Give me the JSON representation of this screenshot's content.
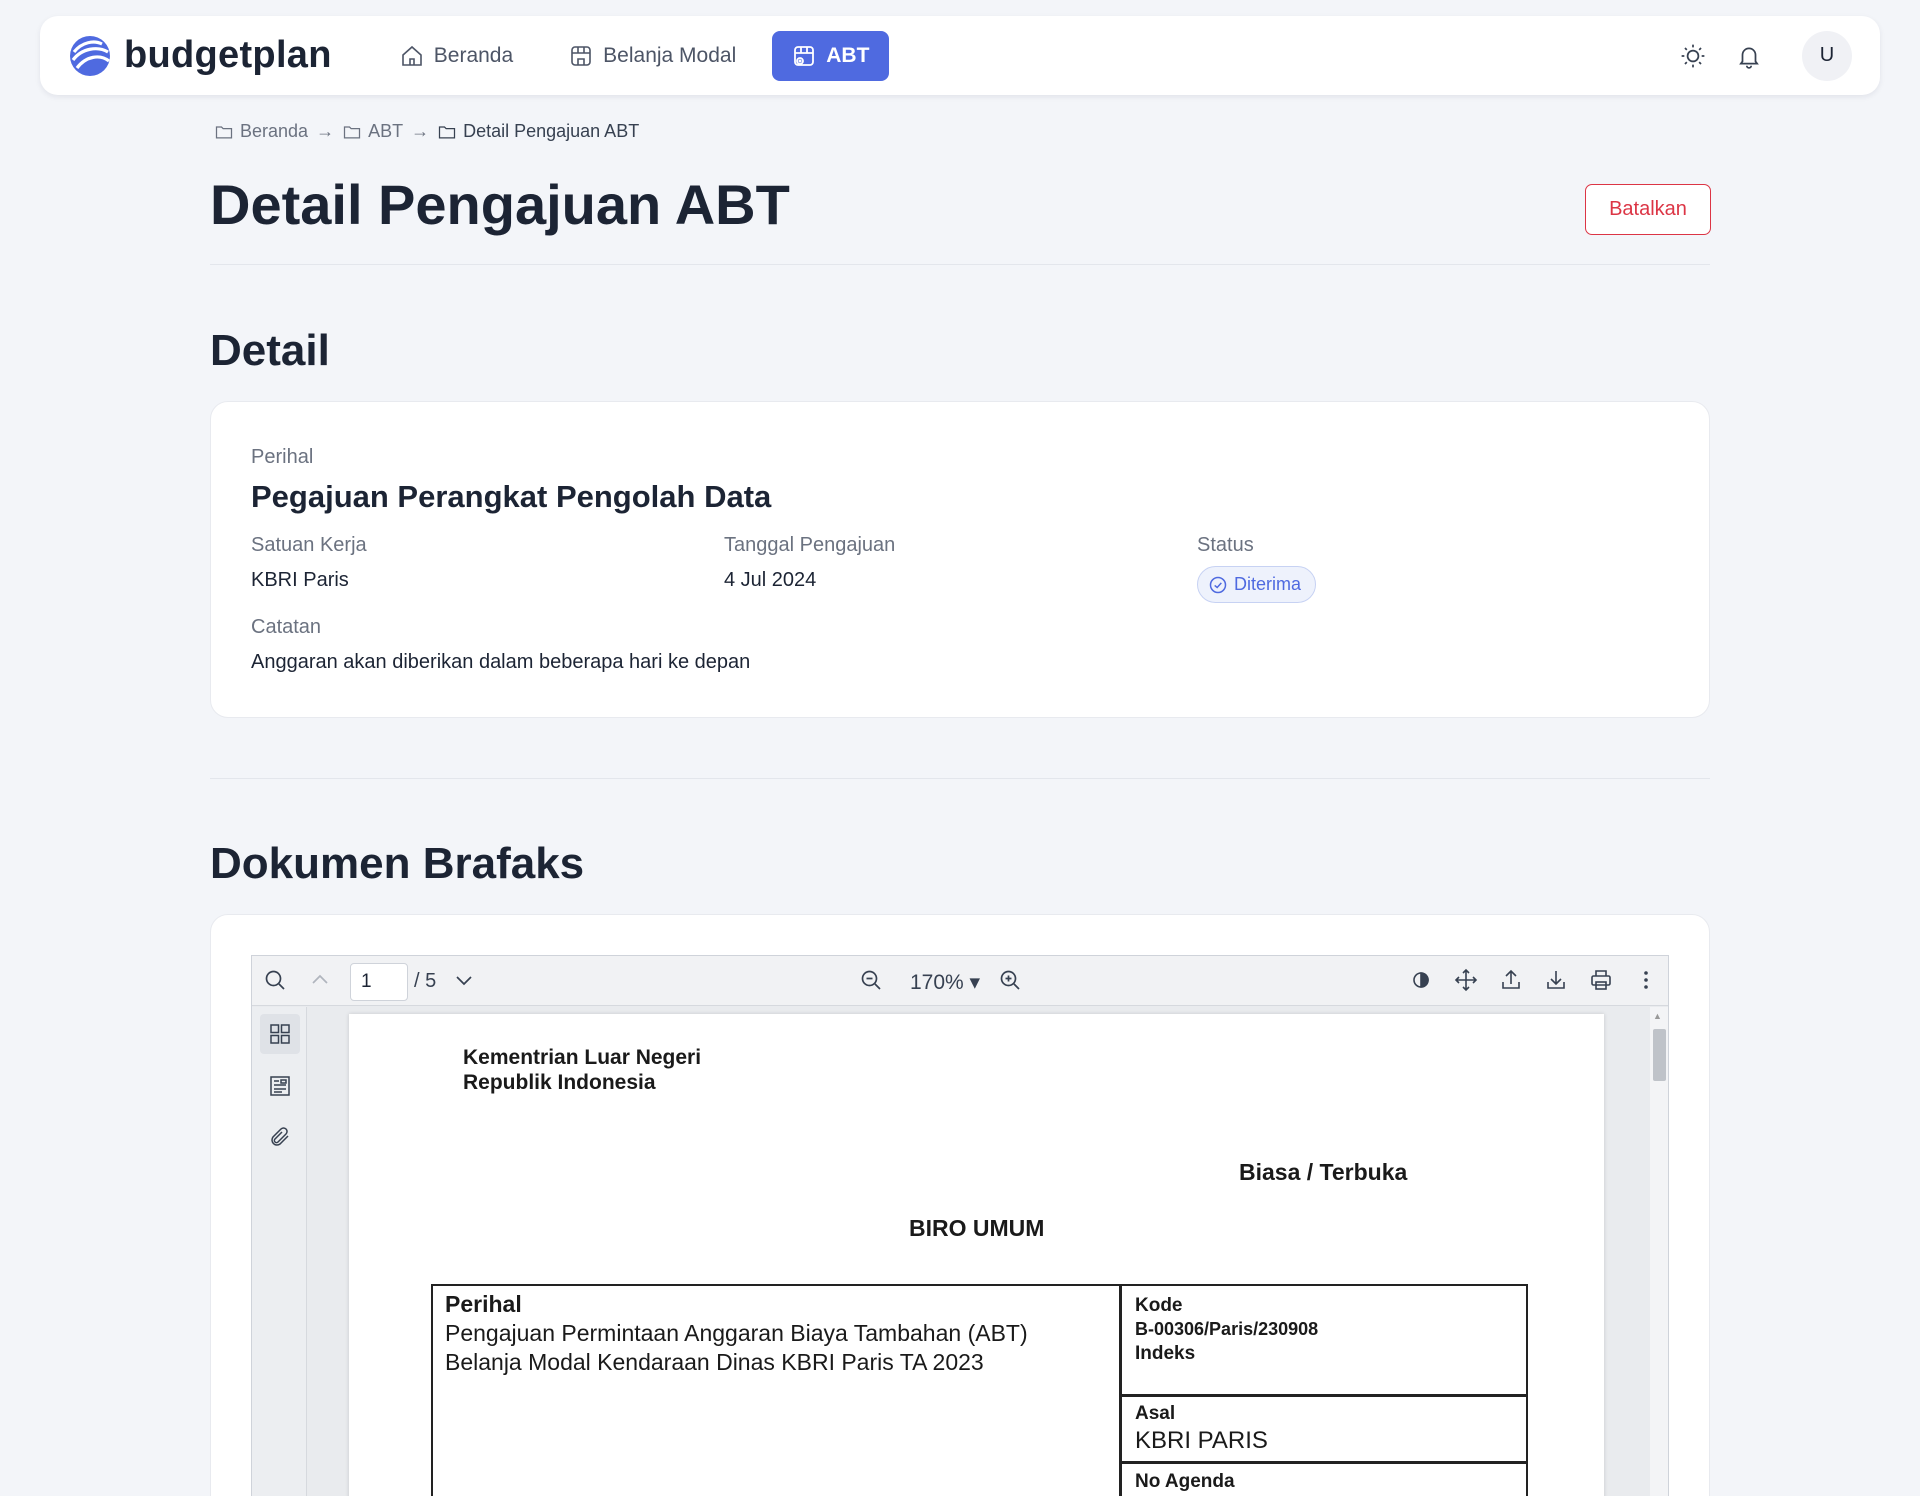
{
  "app": {
    "brand_name": "budgetplan",
    "accent_color": "#4f6ae0",
    "nav": [
      {
        "label": "Beranda",
        "icon": "home-icon",
        "active": false
      },
      {
        "label": "Belanja Modal",
        "icon": "storefront-icon",
        "active": false
      },
      {
        "label": "ABT",
        "icon": "storefront-plus-icon",
        "active": true
      }
    ],
    "header_icons": [
      "sun-icon",
      "bell-icon"
    ],
    "avatar_initial": "U"
  },
  "breadcrumb": [
    {
      "label": "Beranda",
      "icon": "folder-icon"
    },
    {
      "label": "ABT",
      "icon": "folder-icon"
    },
    {
      "label": "Detail Pengajuan ABT",
      "icon": "folder-icon"
    }
  ],
  "page": {
    "title": "Detail Pengajuan ABT",
    "cancel_label": "Batalkan"
  },
  "detail": {
    "section_title": "Detail",
    "perihal_label": "Perihal",
    "perihal_value": "Pegajuan Perangkat Pengolah Data",
    "satuan_kerja_label": "Satuan Kerja",
    "satuan_kerja_value": "KBRI Paris",
    "tanggal_label": "Tanggal Pengajuan",
    "tanggal_value": "4 Jul 2024",
    "status_label": "Status",
    "status_value": "Diterima",
    "catatan_label": "Catatan",
    "catatan_value": "Anggaran akan diberikan dalam beberapa hari ke depan"
  },
  "dokumen": {
    "section_title": "Dokumen Brafaks",
    "viewer": {
      "current_page": "1",
      "total_pages": "/ 5",
      "zoom": "170% ▾"
    },
    "document": {
      "org_line1": "Kementrian Luar Negeri",
      "org_line2": "Republik Indonesia",
      "classification": "Biasa / Terbuka",
      "department": "BIRO UMUM",
      "perihal_heading": "Perihal",
      "perihal_line1": "Pengajuan Permintaan Anggaran Biaya Tambahan (ABT)",
      "perihal_line2": "Belanja Modal Kendaraan Dinas KBRI Paris TA 2023",
      "kode_heading": "Kode",
      "kode_value": "B-00306/Paris/230908",
      "indeks_heading": "Indeks",
      "asal_heading": "Asal",
      "asal_value": "KBRI PARIS",
      "no_agenda_heading": "No Agenda"
    }
  }
}
